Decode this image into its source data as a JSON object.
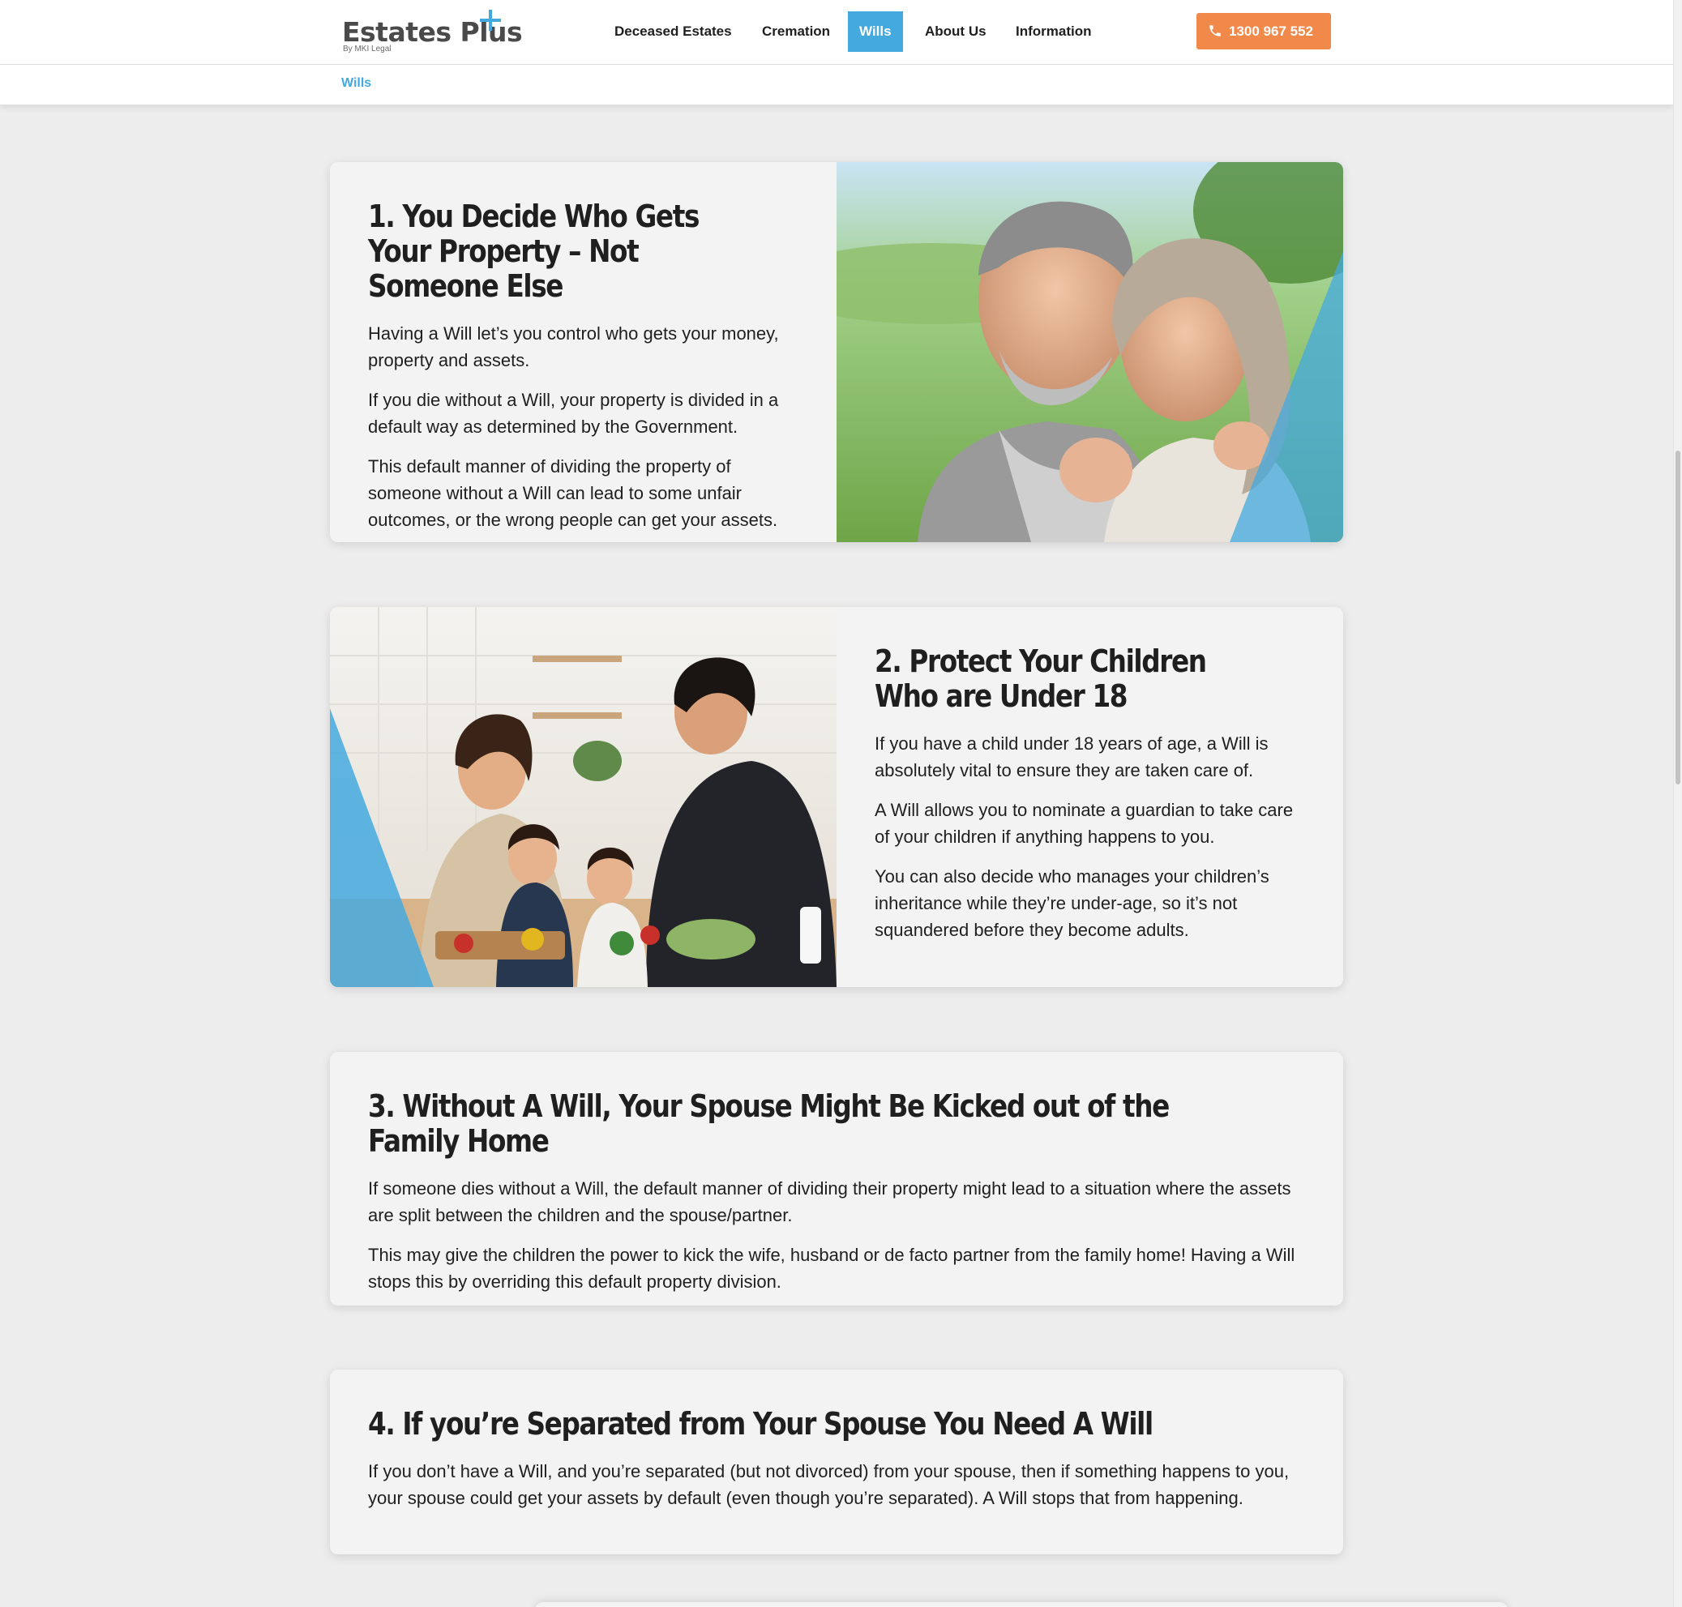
{
  "header": {
    "logo_text": "Estates Plus",
    "logo_sub": "By MKI Legal",
    "nav": [
      {
        "label": "Deceased Estates",
        "active": false
      },
      {
        "label": "Cremation",
        "active": false
      },
      {
        "label": "Wills",
        "active": true
      },
      {
        "label": "About Us",
        "active": false
      },
      {
        "label": "Information",
        "active": false
      }
    ],
    "phone": "1300 967 552",
    "breadcrumb": "Wills"
  },
  "colors": {
    "accent": "#44a9df",
    "phone_button": "#f0894a",
    "card_bg": "#f3f3f3",
    "page_bg": "#ededed"
  },
  "sections": [
    {
      "title": "1. You Decide Who Gets Your Property – Not Someone Else",
      "paragraphs": [
        "Having a Will let’s you control who gets your money, property and assets.",
        "If you die without a Will, your property is divided in a default way as determined by the Government.",
        "This default manner of dividing the property of someone without a Will can lead to some unfair outcomes, or the wrong people can get your assets."
      ],
      "image": "couple-photo"
    },
    {
      "title": "2. Protect Your Children Who are Under 18",
      "paragraphs": [
        "If you have a child under 18 years of age, a Will is absolutely vital to ensure they are taken care of.",
        "A Will allows you to nominate a guardian to take care of your children if anything happens to you.",
        "You can also decide who manages your children’s inheritance while they’re under-age, so it’s not squandered before they become adults."
      ],
      "image": "family-kitchen-photo"
    },
    {
      "title": "3. Without A Will, Your Spouse Might Be Kicked out of the Family Home",
      "paragraphs": [
        "If someone dies without a Will, the default manner of dividing their property might lead to a situation where the assets are split between the children and the spouse/partner.",
        "This may give the children the power to kick the wife, husband or de facto partner from the family home! Having a Will stops this by overriding this default property division."
      ]
    },
    {
      "title": "4. If you’re Separated from Your Spouse You Need A Will",
      "paragraphs": [
        "If you don’t have a Will, and you’re separated (but not divorced) from your spouse, then if something happens to you, your spouse could get your assets by default (even though you’re separated). A Will stops that from happening."
      ]
    }
  ]
}
